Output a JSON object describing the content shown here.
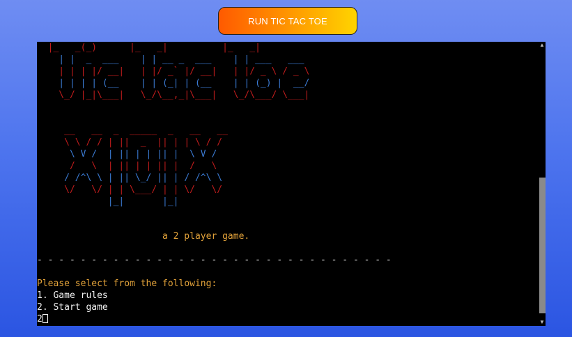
{
  "run_button": {
    "label": "RUN TIC TAC TOE"
  },
  "terminal": {
    "banner_tictactoe": [
      {
        "text": "  |_   _(_)      |_   _|          |_   _|",
        "color": "red"
      },
      {
        "text": "    | |  _  ___    | | __ _  ___    | | ___   ___",
        "color": "blue"
      },
      {
        "text": "    | | | |/ __|   | |/ _` |/ __|   | |/ _ \\ / _ \\",
        "color": "red"
      },
      {
        "text": "    | | | | (__    | | (_| | (__    | | (_) |  __/",
        "color": "blue"
      },
      {
        "text": "    \\_/ |_|\\___|   \\_/\\__,_|\\___|   \\_/\\___/ \\___|",
        "color": "red"
      }
    ],
    "banner_xmox": [
      {
        "text": "     __   __  _  _____  _   __   __",
        "color": "red"
      },
      {
        "text": "     \\ \\ / / | ||  _  || | | \\ / /",
        "color": "red"
      },
      {
        "text": "      \\ V /  | || | | || |  \\ V /",
        "color": "blue"
      },
      {
        "text": "      /   \\  | || | | || |  /   \\",
        "color": "red"
      },
      {
        "text": "     / /^\\ \\ | || \\_/ || | / /^\\ \\",
        "color": "blue"
      },
      {
        "text": "     \\/   \\/ | | \\___/ | | \\/   \\/",
        "color": "red"
      },
      {
        "text": "             |_|       |_|",
        "color": "blue"
      }
    ],
    "tagline": "a 2 player game.",
    "divider": "- - - - - - - - - - - - - - - - - - - - - - - - - - - - - - - - -",
    "prompt": "Please select from the following:",
    "options": [
      "1. Game rules",
      "2. Start game"
    ],
    "input_value": "2"
  },
  "colors": {
    "red": "#c01c1c",
    "blue": "#3b7bd4",
    "orange": "#e2a23a"
  }
}
